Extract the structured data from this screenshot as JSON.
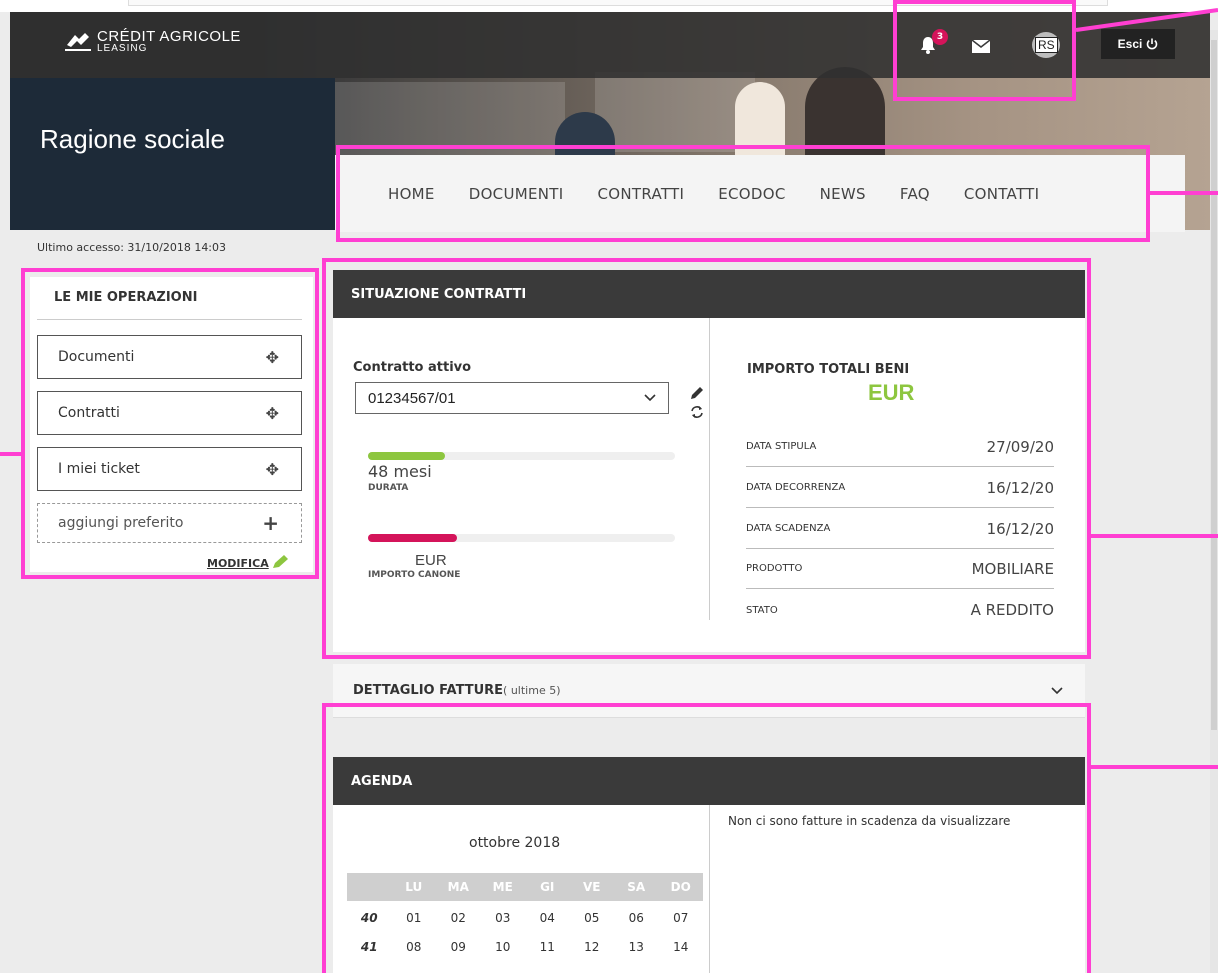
{
  "brand": {
    "name": "CRÉDIT AGRICOLE",
    "sub": "LEASING"
  },
  "header": {
    "notifications_count": "3",
    "avatar_initials": "RS",
    "logout_label": "Esci",
    "company_name": "Ragione sociale"
  },
  "nav": [
    "HOME",
    "DOCUMENTI",
    "CONTRATTI",
    "ECODOC",
    "NEWS",
    "FAQ",
    "CONTATTI"
  ],
  "last_access": "Ultimo accesso: 31/10/2018 14:03",
  "sidebar": {
    "title": "LE MIE OPERAZIONI",
    "items": [
      "Documenti",
      "Contratti",
      "I miei ticket"
    ],
    "add_favorite": "aggiungi preferito",
    "edit_label": "MODIFICA"
  },
  "contracts": {
    "title": "SITUAZIONE CONTRATTI",
    "active_label": "Contratto attivo",
    "selected_contract": "01234567/01",
    "duration_value": "48 mesi",
    "duration_label": "DURATA",
    "duration_progress": 0.25,
    "installment_value": "EUR",
    "installment_label": "IMPORTO CANONE",
    "installment_progress": 0.29,
    "total_title": "IMPORTO TOTALI BENI",
    "total_value": "EUR",
    "details": [
      {
        "key": "DATA STIPULA",
        "value": "27/09/20"
      },
      {
        "key": "DATA DECORRENZA",
        "value": "16/12/20"
      },
      {
        "key": "DATA SCADENZA",
        "value": "16/12/20"
      },
      {
        "key": "PRODOTTO",
        "value": "MOBILIARE"
      },
      {
        "key": "STATO",
        "value": "A REDDITO"
      }
    ]
  },
  "invoices": {
    "title": "DETTAGLIO FATTURE",
    "subtitle": "( ultime 5)"
  },
  "agenda": {
    "title": "AGENDA",
    "month": "ottobre 2018",
    "weekdays": [
      "LU",
      "MA",
      "ME",
      "GI",
      "VE",
      "SA",
      "DO"
    ],
    "weeks": [
      {
        "week": "40",
        "days": [
          "01",
          "02",
          "03",
          "04",
          "05",
          "06",
          "07"
        ]
      },
      {
        "week": "41",
        "days": [
          "08",
          "09",
          "10",
          "11",
          "12",
          "13",
          "14"
        ]
      }
    ],
    "message": "Non ci sono fatture in scadenza da visualizzare"
  },
  "colors": {
    "green": "#8dc63f",
    "magenta": "#d4145a",
    "annotation": "#ff3fd2"
  }
}
